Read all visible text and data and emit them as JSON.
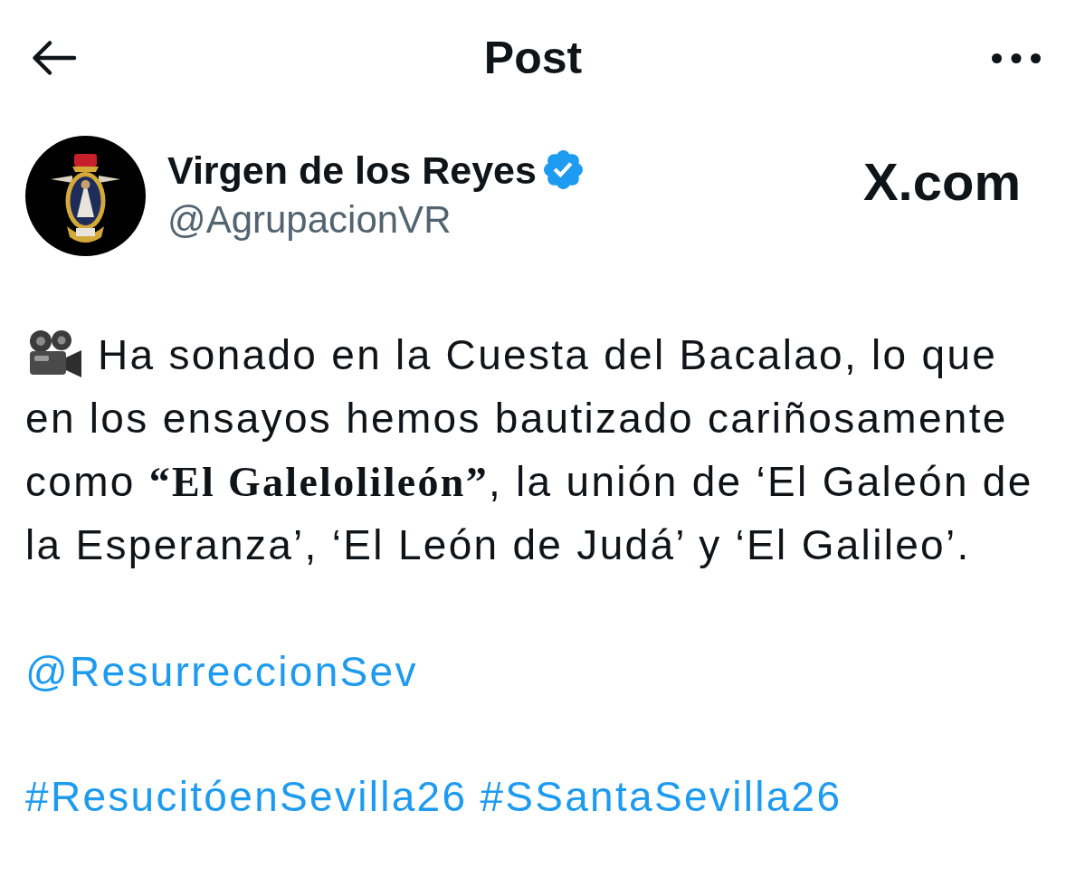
{
  "header": {
    "title": "Post"
  },
  "author": {
    "name": "Virgen de los Reyes",
    "verified": true,
    "handle": "@AgrupacionVR"
  },
  "site_label": "X.com",
  "post": {
    "lines": [
      "Ha sonado en la Cuesta del Bacalao, lo que",
      "en los ensayos hemos bautizado cariñosamente",
      "como **“El Galelolileón”**, la unión de ‘El Galeón de",
      "la Esperanza’, ‘El León de Judá’ y ‘El Galileo’."
    ],
    "mention": "@ResurreccionSev",
    "hashtags": [
      "#ResucitóenSevilla26",
      "#SSantaSevilla26"
    ]
  }
}
